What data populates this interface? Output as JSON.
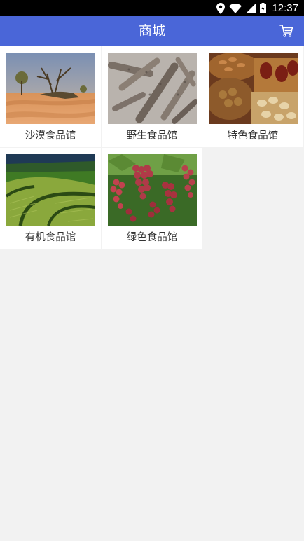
{
  "status_bar": {
    "time": "12:37",
    "icons": [
      "location-icon",
      "wifi-icon",
      "signal-icon",
      "battery-icon"
    ]
  },
  "app_bar": {
    "title": "商城",
    "cart_icon": "cart-icon",
    "color": "#4a66d8"
  },
  "categories": [
    {
      "label": "沙漠食品馆",
      "image": "desert-landscape-image"
    },
    {
      "label": "野生食品馆",
      "image": "wild-roots-image"
    },
    {
      "label": "特色食品馆",
      "image": "nuts-baskets-image"
    },
    {
      "label": "有机食品馆",
      "image": "terraced-fields-image"
    },
    {
      "label": "绿色食品馆",
      "image": "grapes-vine-image"
    }
  ]
}
